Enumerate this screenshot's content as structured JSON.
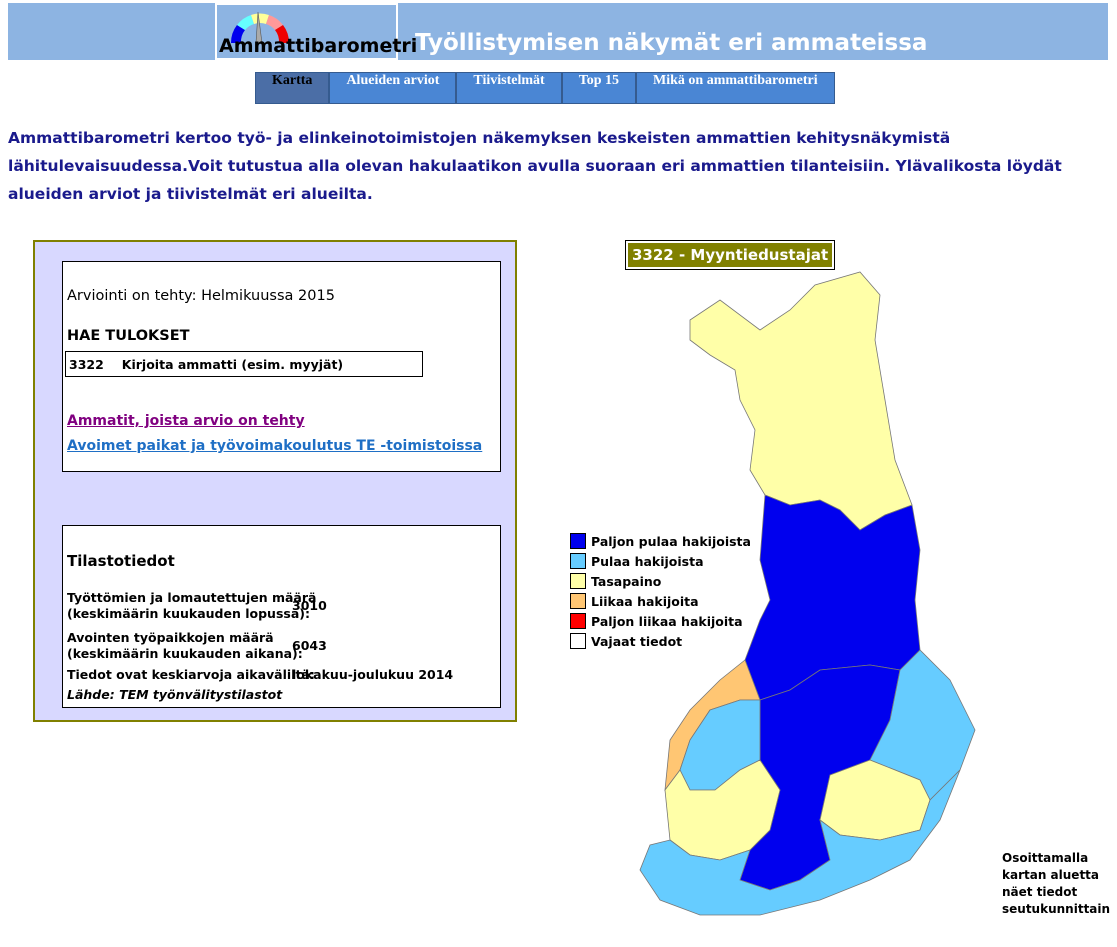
{
  "header": {
    "logo_text": "Ammattibarometri",
    "title": "Työllistymisen näkymät eri ammateissa"
  },
  "nav": [
    {
      "label": "Kartta",
      "active": true
    },
    {
      "label": "Alueiden arviot"
    },
    {
      "label": "Tiivistelmät"
    },
    {
      "label": "Top 15"
    },
    {
      "label": "Mikä on ammattibarometri"
    }
  ],
  "intro": "Ammattibarometri kertoo työ- ja elinkeinotoimistojen näkemyksen keskeisten ammattien kehitysnäkymistä lähitulevaisuudessa.Voit tutustua alla olevan hakulaatikon avulla suoraan eri ammattien tilanteisiin. Ylävalikosta löydät alueiden arviot ja tiivistelmät eri alueilta.",
  "search": {
    "assessment": "Arviointi on tehty: Helmikuussa 2015",
    "heading": "HAE TULOKSET",
    "code": "3322",
    "placeholder": "Kirjoita ammatti (esim. myyjät)",
    "link1": "Ammatit, joista arvio on tehty",
    "link2": "Avoimet paikat ja työvoimakoulutus TE -toimistoissa"
  },
  "stats": {
    "title": "Tilastotiedot",
    "unemployed_label1": "Työttömien ja lomautettujen määrä",
    "unemployed_label2": "(keskimäärin kuukauden lopussa):",
    "unemployed_value": "3010",
    "vacancies_label1": "Avointen työpaikkojen määrä",
    "vacancies_label2": "(keskimäärin kuukauden aikana):",
    "vacancies_value": "6043",
    "period_label": "Tiedot ovat keskiarvoja aikaväliltä:",
    "period_value": "lokakuu-joulukuu 2014",
    "source": "Lähde: TEM työnvälitystilastot"
  },
  "map": {
    "title": "3322 - Myyntiedustajat",
    "hint": "Osoittamalla kartan aluetta näet tiedot seutukunnittain"
  },
  "legend": [
    {
      "label": "Paljon pulaa hakijoista",
      "color": "#0000ee"
    },
    {
      "label": "Pulaa hakijoista",
      "color": "#66ccff"
    },
    {
      "label": "Tasapaino",
      "color": "#ffffa8"
    },
    {
      "label": "Liikaa hakijoita",
      "color": "#ffc673"
    },
    {
      "label": "Paljon liikaa hakijoita",
      "color": "#ff0000"
    },
    {
      "label": "Vajaat tiedot",
      "color": "#ffffff"
    }
  ]
}
